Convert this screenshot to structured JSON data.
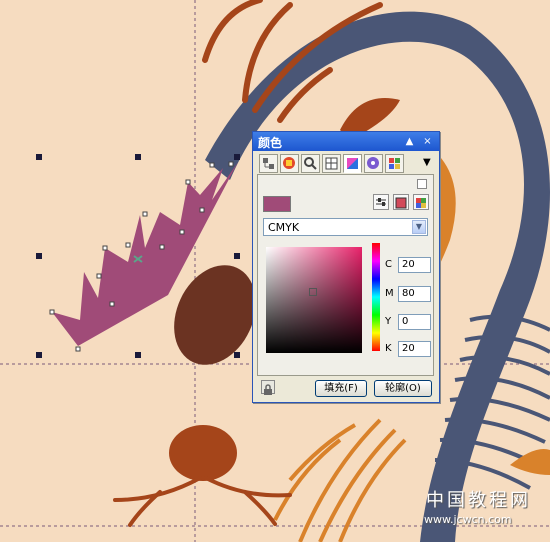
{
  "docker": {
    "title": "颜色",
    "btn_pin": "▲",
    "btn_close": "×",
    "tabs": [
      "color-harmony-tab",
      "palette-tab",
      "zoom-tab",
      "grid-tab",
      "color-tab",
      "object-tab",
      "more-tab"
    ],
    "tab_more": "▼",
    "current_color": "#a04b78",
    "model_select": {
      "value": "CMYK",
      "arrow": "▼"
    },
    "channels": [
      {
        "label": "C",
        "value": "20"
      },
      {
        "label": "M",
        "value": "80"
      },
      {
        "label": "Y",
        "value": "0"
      },
      {
        "label": "K",
        "value": "20"
      }
    ],
    "fill_button": "填充(F)",
    "outline_button": "轮廓(O)"
  },
  "watermark": {
    "line1": "中国教程网",
    "line2": "www.jcwcn.com"
  },
  "colors": {
    "background": "#f6dcc0",
    "navy": "#4a5676",
    "rust": "#a5451a",
    "orange": "#d9822b",
    "magenta": "#a04b78",
    "brown_ellipse": "#6b3322"
  }
}
